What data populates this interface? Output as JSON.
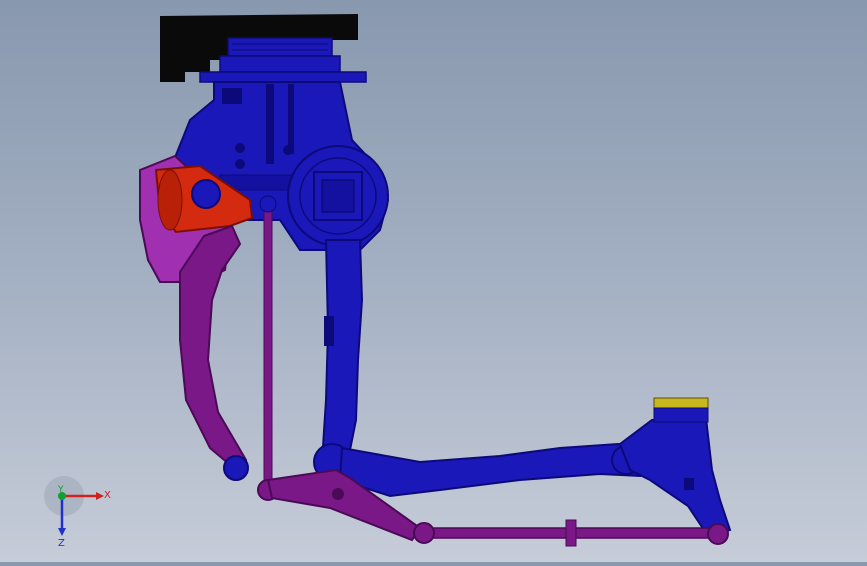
{
  "viewport": {
    "background_top": "#8898ae",
    "background_bottom": "#c6ccd8"
  },
  "colors": {
    "base": "#0a0a0a",
    "body": "#1a18b8",
    "body_dark": "#0c0a7a",
    "arm": "#7a1888",
    "arm_dark": "#4a0a55",
    "arm_light": "#a030b0",
    "motor": "#d42a10",
    "flange": "#c8b820"
  },
  "triad": {
    "x_label": "X",
    "y_label": "Y",
    "z_label": "Z",
    "x_color": "#d02020",
    "y_color": "#10a030",
    "z_color": "#2030c8"
  },
  "icons": {
    "triad": "coordinate-triad-icon"
  }
}
